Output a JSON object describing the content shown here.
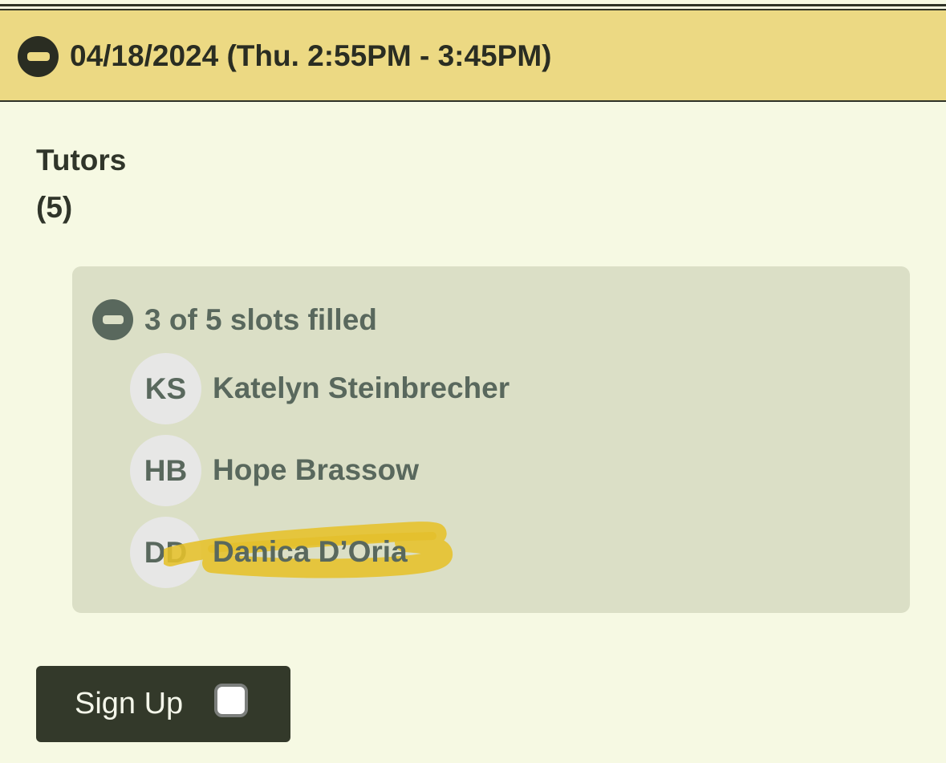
{
  "slot": {
    "date_label": "04/18/2024 (Thu. 2:55PM - 3:45PM)"
  },
  "role": {
    "title": "Tutors",
    "count": "(5)",
    "slots_summary": "3 of 5 slots filled",
    "slots_filled": 3,
    "slots_total": 5
  },
  "participants": [
    {
      "initials": "KS",
      "name": "Katelyn Steinbrecher"
    },
    {
      "initials": "HB",
      "name": "Hope Brassow"
    },
    {
      "initials": "DD",
      "name": "Danica D’Oria"
    }
  ],
  "signup": {
    "label": "Sign Up",
    "checked": false
  },
  "colors": {
    "page_background": "#f6f9e3",
    "date_bar": "#ecd983",
    "panel": "#dbdfc6",
    "accent_text": "#59685d",
    "button": "#33392a",
    "highlighter": "#e6c12a"
  }
}
